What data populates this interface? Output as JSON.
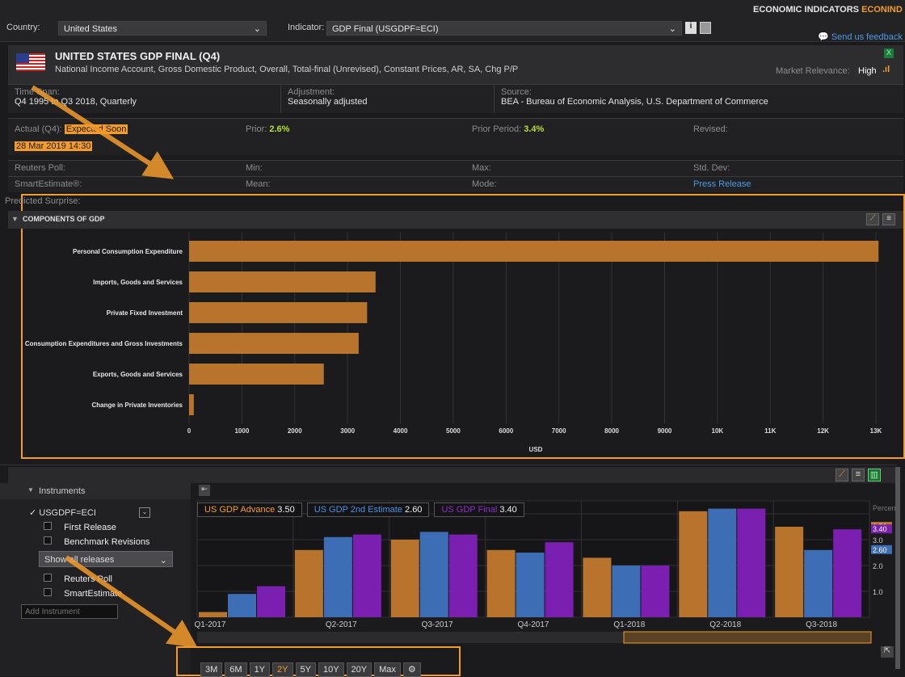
{
  "top": {
    "country_label": "Country:",
    "country": "United States",
    "indicator_label": "Indicator:",
    "indicator": "GDP Final (USGDPF=ECI)",
    "app_title": "ECONOMIC INDICATORS",
    "app_code": "ECONIND",
    "feedback": "Send us feedback"
  },
  "header": {
    "title": "UNITED STATES GDP FINAL (Q4)",
    "subtitle": "National Income Account, Gross Domestic Product, Overall, Total-final (Unrevised), Constant Prices, AR, SA, Chg P/P",
    "relevance_label": "Market Relevance:",
    "relevance": "High"
  },
  "meta": {
    "timespan_label": "Time Span:",
    "timespan": "Q4 1995 to Q3 2018, Quarterly",
    "adjustment_label": "Adjustment:",
    "adjustment": "Seasonally adjusted",
    "source_label": "Source:",
    "source": "BEA - Bureau of Economic Analysis, U.S. Department of Commerce"
  },
  "stats": {
    "actual_label": "Actual (Q4):",
    "actual": "Expected Soon",
    "date": "28 Mar 2019 14:30",
    "prior_label": "Prior:",
    "prior": "2.6%",
    "prior_period_label": "Prior Period:",
    "prior_period": "3.4%",
    "revised_label": "Revised:",
    "reuters_poll": "Reuters Poll:",
    "min": "Min:",
    "max": "Max:",
    "stddev": "Std. Dev:",
    "smartestimate": "SmartEstimate®:",
    "mean": "Mean:",
    "mode": "Mode:",
    "press_release": "Press Release",
    "predicted": "Predicted Surprise:"
  },
  "components": {
    "title": "COMPONENTS OF GDP"
  },
  "chart_data": [
    {
      "type": "bar",
      "orientation": "horizontal",
      "categories": [
        "Personal Consumption Expenditure",
        "Imports, Goods and Services",
        "Private Fixed Investment",
        "Consumption Expenditures and Gross Investments",
        "Exports, Goods and Services",
        "Change in Private Inventories"
      ],
      "values": [
        13050,
        3530,
        3370,
        3210,
        2550,
        90
      ],
      "xlabel": "USD",
      "xticks": [
        "0",
        "1000",
        "2000",
        "3000",
        "4000",
        "5000",
        "6000",
        "7000",
        "8000",
        "9000",
        "10K",
        "11K",
        "12K",
        "13K"
      ],
      "xlim": [
        0,
        13000
      ],
      "color": "#b8732d"
    },
    {
      "type": "bar",
      "categories": [
        "Q1-2017",
        "Q2-2017",
        "Q3-2017",
        "Q4-2017",
        "Q1-2018",
        "Q2-2018",
        "Q3-2018"
      ],
      "series": [
        {
          "name": "US GDP Advance",
          "values": [
            0.2,
            2.6,
            3.0,
            2.6,
            2.3,
            4.1,
            3.5
          ],
          "color": "#b8732d"
        },
        {
          "name": "US GDP 2nd Estimate",
          "values": [
            0.9,
            3.1,
            3.3,
            2.5,
            2.0,
            4.2,
            2.6
          ],
          "color": "#3d6db5"
        },
        {
          "name": "US GDP Final",
          "values": [
            1.2,
            3.2,
            3.2,
            2.9,
            2.0,
            4.2,
            3.4
          ],
          "color": "#7a1fb0"
        }
      ],
      "yticks": [
        "1.0",
        "2.0",
        "3.0"
      ],
      "ylim": [
        0,
        4.5
      ],
      "ylabel": "Percent",
      "markers": [
        "3.50",
        "3.40",
        "2.60"
      ]
    }
  ],
  "instruments": {
    "title": "Instruments",
    "ric": "USGDPF=ECI",
    "first_release": "First Release",
    "benchmark": "Benchmark Revisions",
    "show_all": "Show all releases",
    "reuters_poll": "Reuters Poll",
    "smartestimate": "SmartEstimate",
    "add_placeholder": "Add Instrument"
  },
  "legend": [
    {
      "name": "US GDP Advance",
      "value": "3.50",
      "color": "#f39c2a"
    },
    {
      "name": "US GDP 2nd Estimate",
      "value": "2.60",
      "color": "#4a90e2"
    },
    {
      "name": "US GDP Final",
      "value": "3.40",
      "color": "#8e2ec9"
    }
  ],
  "ranges": [
    "3M",
    "6M",
    "1Y",
    "2Y",
    "5Y",
    "10Y",
    "20Y",
    "Max"
  ],
  "active_range": "2Y"
}
